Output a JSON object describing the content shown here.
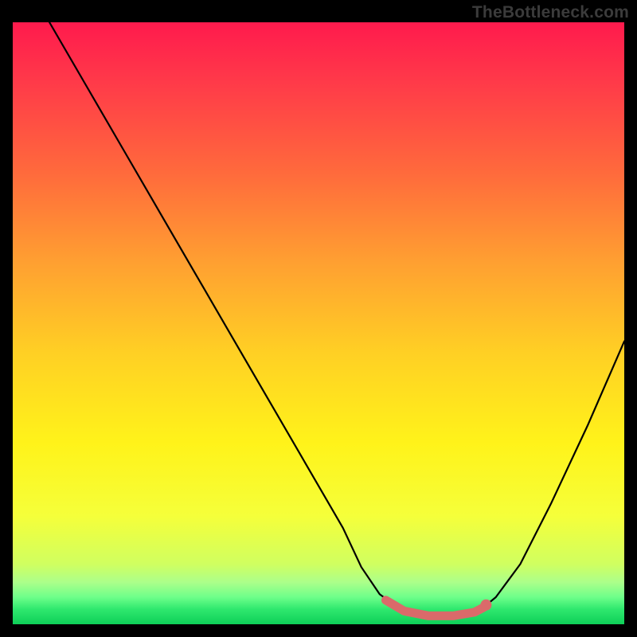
{
  "attribution": "TheBottleneck.com",
  "chart_data": {
    "type": "line",
    "title": "",
    "xlabel": "",
    "ylabel": "",
    "x_range": [
      0,
      1
    ],
    "y_range": [
      0,
      1
    ],
    "series": [
      {
        "name": "curve",
        "color": "#000000",
        "points": [
          {
            "x": 0.06,
            "y": 1.0
          },
          {
            "x": 0.12,
            "y": 0.895
          },
          {
            "x": 0.18,
            "y": 0.79
          },
          {
            "x": 0.24,
            "y": 0.685
          },
          {
            "x": 0.3,
            "y": 0.58
          },
          {
            "x": 0.36,
            "y": 0.475
          },
          {
            "x": 0.42,
            "y": 0.37
          },
          {
            "x": 0.48,
            "y": 0.265
          },
          {
            "x": 0.54,
            "y": 0.16
          },
          {
            "x": 0.57,
            "y": 0.095
          },
          {
            "x": 0.6,
            "y": 0.05
          },
          {
            "x": 0.64,
            "y": 0.02
          },
          {
            "x": 0.705,
            "y": 0.01
          },
          {
            "x": 0.76,
            "y": 0.02
          },
          {
            "x": 0.79,
            "y": 0.045
          },
          {
            "x": 0.83,
            "y": 0.1
          },
          {
            "x": 0.88,
            "y": 0.2
          },
          {
            "x": 0.94,
            "y": 0.33
          },
          {
            "x": 1.0,
            "y": 0.47
          }
        ]
      },
      {
        "name": "highlight",
        "color": "#da6a6a",
        "points": [
          {
            "x": 0.61,
            "y": 0.04
          },
          {
            "x": 0.64,
            "y": 0.022
          },
          {
            "x": 0.68,
            "y": 0.014
          },
          {
            "x": 0.72,
            "y": 0.014
          },
          {
            "x": 0.755,
            "y": 0.02
          },
          {
            "x": 0.77,
            "y": 0.028
          }
        ]
      }
    ],
    "marker": {
      "x": 0.774,
      "y": 0.032,
      "color": "#da6a6a"
    },
    "gradient_stops": [
      {
        "offset": 0.0,
        "color": "#ff1a4d"
      },
      {
        "offset": 0.1,
        "color": "#ff3a49"
      },
      {
        "offset": 0.25,
        "color": "#ff6a3c"
      },
      {
        "offset": 0.4,
        "color": "#ffa031"
      },
      {
        "offset": 0.55,
        "color": "#ffd024"
      },
      {
        "offset": 0.7,
        "color": "#fff31a"
      },
      {
        "offset": 0.82,
        "color": "#f5ff3a"
      },
      {
        "offset": 0.9,
        "color": "#d0ff60"
      },
      {
        "offset": 0.93,
        "color": "#acff8a"
      },
      {
        "offset": 0.955,
        "color": "#6eff8a"
      },
      {
        "offset": 0.975,
        "color": "#2fe86e"
      },
      {
        "offset": 1.0,
        "color": "#0ecf58"
      }
    ],
    "green_band": {
      "y0": 0.0,
      "y1": 0.07
    }
  }
}
